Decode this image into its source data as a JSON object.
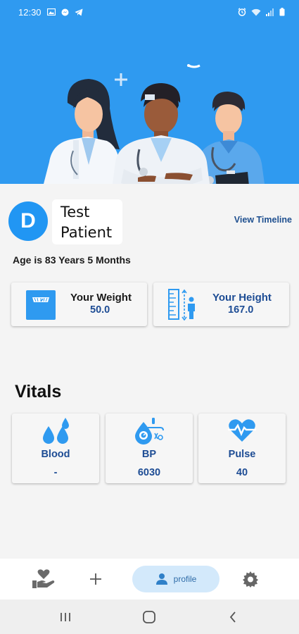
{
  "status_bar": {
    "time": "12:30"
  },
  "patient": {
    "avatar_initial": "D",
    "name_line1": "Test",
    "name_line2": "Patient",
    "view_timeline_label": "View Timeline",
    "age_text": "Age is 83 Years 5 Months"
  },
  "measurements": {
    "weight": {
      "title": "Your Weight",
      "value": "50.0"
    },
    "height": {
      "title": "Your Height",
      "value": "167.0"
    }
  },
  "vitals": {
    "title": "Vitals",
    "items": [
      {
        "label": "Blood",
        "value": "-",
        "icon": "blood-drops-icon"
      },
      {
        "label": "BP",
        "value": "6030",
        "icon": "blood-pressure-icon"
      },
      {
        "label": "Pulse",
        "value": "40",
        "icon": "heart-pulse-icon"
      }
    ]
  },
  "bottom_nav": {
    "items": [
      {
        "icon": "hand-heart-icon"
      },
      {
        "icon": "plus-icon"
      },
      {
        "icon": "person-icon",
        "label": "profile",
        "selected": true
      },
      {
        "icon": "gear-icon"
      }
    ]
  },
  "colors": {
    "primary": "#2f9af0",
    "avatar": "#2196f3",
    "accent_text": "#1d4c94",
    "nav_selected_bg": "#d3e9fb"
  }
}
